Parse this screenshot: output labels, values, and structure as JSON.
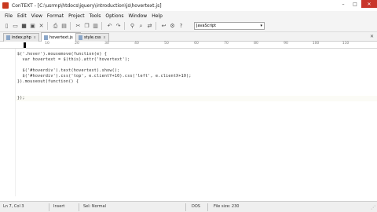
{
  "window": {
    "title": "ConTEXT - [C:\\usrmp\\htdocs\\jquery\\introduction\\js\\hovertext.js]",
    "minimize": "–",
    "maximize": "□",
    "close": "✕"
  },
  "menu": {
    "items": [
      "File",
      "Edit",
      "View",
      "Format",
      "Project",
      "Tools",
      "Options",
      "Window",
      "Help"
    ]
  },
  "toolbar": {
    "language": "JavaScript",
    "dropdown_arrow": "▾"
  },
  "tabs": [
    {
      "label": "index.php",
      "close": "x"
    },
    {
      "label": "hovertext.js",
      "close": "x"
    },
    {
      "label": "style.css",
      "close": "x"
    }
  ],
  "tabbar_close": "✕",
  "ruler": {
    "ticks": [
      "10",
      "20",
      "30",
      "40",
      "50",
      "60",
      "70",
      "80",
      "90",
      "100",
      "110"
    ]
  },
  "code": {
    "lines": [
      "$('.hover').mousemove(function(e) {",
      "  var hovertext = $(this).attr('hovertext');",
      "",
      "  $('#hoverdiv').text(hovertext).show();",
      "  $('#hoverdiv').css('top', e.clientY+10).css('left', e.clientX+10);",
      "}).mouseout(function() {",
      "",
      "});"
    ]
  },
  "status": {
    "position": "Ln 7, Col 3",
    "mode": "Insert",
    "selection": "Sel: Normal",
    "format": "DOS",
    "filesize": "File size: 230"
  }
}
